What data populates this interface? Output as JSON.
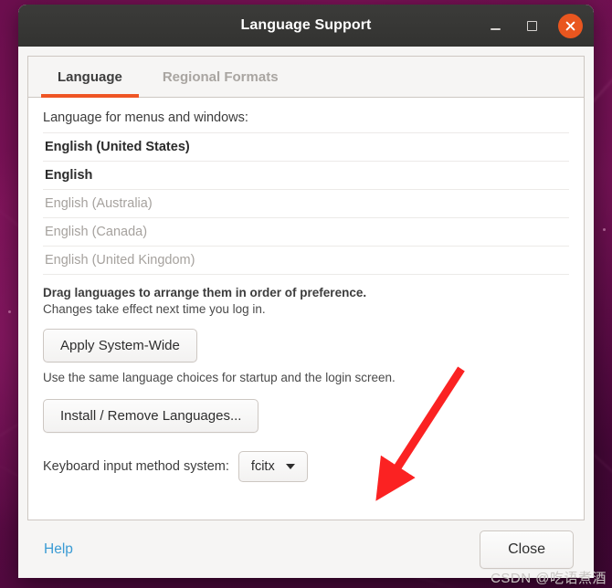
{
  "window": {
    "title": "Language Support",
    "controls": {
      "minimize_label": "Minimize",
      "maximize_label": "Maximize",
      "close_label": "Close window"
    }
  },
  "tabs": [
    {
      "label": "Language",
      "active": true
    },
    {
      "label": "Regional Formats",
      "active": false
    }
  ],
  "language_tab": {
    "list_label": "Language for menus and windows:",
    "languages": [
      {
        "name": "English (United States)",
        "enabled": true
      },
      {
        "name": "English",
        "enabled": true
      },
      {
        "name": "English (Australia)",
        "enabled": false
      },
      {
        "name": "English (Canada)",
        "enabled": false
      },
      {
        "name": "English (United Kingdom)",
        "enabled": false
      }
    ],
    "drag_hint": "Drag languages to arrange them in order of preference.",
    "changes_hint": "Changes take effect next time you log in.",
    "apply_button": "Apply System-Wide",
    "apply_description": "Use the same language choices for startup and the login screen.",
    "install_button": "Install / Remove Languages...",
    "keyboard_label": "Keyboard input method system:",
    "keyboard_value": "fcitx"
  },
  "actions": {
    "help_label": "Help",
    "close_label": "Close"
  },
  "annotation": {
    "arrow_color": "#fb2222",
    "watermark": "CSDN @吃语煮酒"
  },
  "colors": {
    "accent_orange": "#ef5524",
    "titlebar": "#363634",
    "link_blue": "#3a9bd4",
    "close_circle": "#e9561f"
  }
}
